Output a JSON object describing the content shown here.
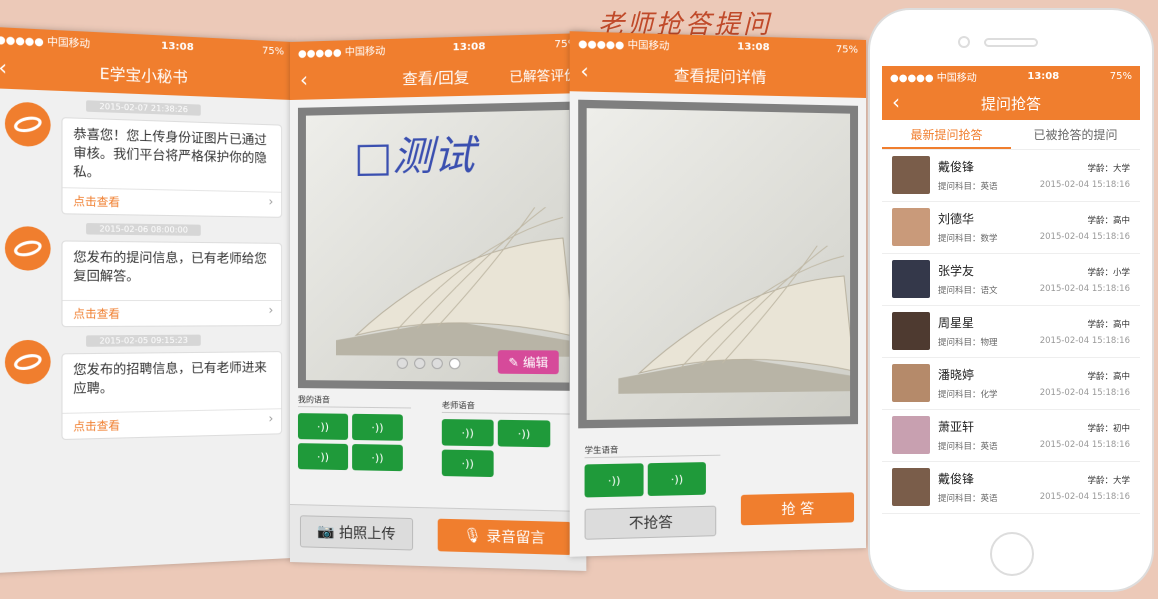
{
  "headline": "老师抢答提问",
  "status": {
    "carrier": "●●●●● 中国移动",
    "time": "13:08",
    "battery": "75%"
  },
  "p1": {
    "title": "E学宝小秘书",
    "messages": [
      {
        "ts": "2015-02-07 21:38:26",
        "text": "恭喜您！您上传身份证图片已通过审核。我们平台将严格保护你的隐私。",
        "link": "点击查看"
      },
      {
        "ts": "2015-02-06 08:00:00",
        "text": "您发布的提问信息，已有老师给您复回解答。",
        "link": "点击查看"
      },
      {
        "ts": "2015-02-05 09:15:23",
        "text": "您发布的招聘信息，已有老师进来应聘。",
        "link": "点击查看"
      }
    ]
  },
  "p2": {
    "title": "查看/回复",
    "right_action": "已解答评价",
    "handwriting": "□测试",
    "edit": "编辑",
    "my_voice": "我的语音",
    "teacher_voice": "老师语音",
    "voice_icon": "·))",
    "photo_upload": "拍照上传",
    "record": "录音留言"
  },
  "p3": {
    "title": "查看提问详情",
    "student_voice": "学生语音",
    "no_grab": "不抢答",
    "grab": "抢 答"
  },
  "p4": {
    "title": "提问抢答",
    "tab_new": "最新提问抢答",
    "tab_taken": "已被抢答的提问",
    "rows": [
      {
        "name": "戴俊锋",
        "level": "学龄：大学",
        "subject": "提问科目：英语",
        "date": "2015-02-04 15:18:16",
        "color": "#7a5d4a"
      },
      {
        "name": "刘德华",
        "level": "学龄：高中",
        "subject": "提问科目：数学",
        "date": "2015-02-04 15:18:16",
        "color": "#c99a7a"
      },
      {
        "name": "张学友",
        "level": "学龄：小学",
        "subject": "提问科目：语文",
        "date": "2015-02-04 15:18:16",
        "color": "#34384a"
      },
      {
        "name": "周星星",
        "level": "学龄：高中",
        "subject": "提问科目：物理",
        "date": "2015-02-04 15:18:16",
        "color": "#4e3a30"
      },
      {
        "name": "潘晓婷",
        "level": "学龄：高中",
        "subject": "提问科目：化学",
        "date": "2015-02-04 15:18:16",
        "color": "#b58a6a"
      },
      {
        "name": "萧亚轩",
        "level": "学龄：初中",
        "subject": "提问科目：英语",
        "date": "2015-02-04 15:18:16",
        "color": "#c8a0b0"
      },
      {
        "name": "戴俊锋",
        "level": "学龄：大学",
        "subject": "提问科目：英语",
        "date": "2015-02-04 15:18:16",
        "color": "#7a5d4a"
      }
    ]
  }
}
